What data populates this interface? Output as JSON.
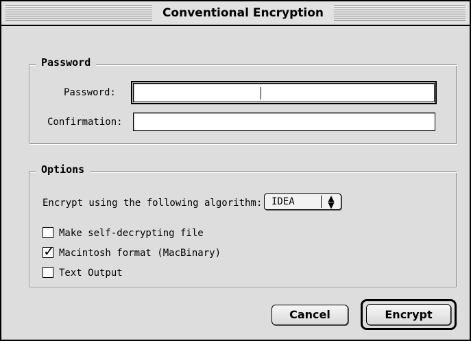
{
  "window": {
    "title": "Conventional Encryption"
  },
  "password_group": {
    "label": "Password",
    "password_label": "Password:",
    "password_value": "",
    "confirmation_label": "Confirmation:",
    "confirmation_value": ""
  },
  "options_group": {
    "label": "Options",
    "algorithm_label": "Encrypt using the following algorithm:",
    "algorithm_selected": "IDEA",
    "checkboxes": [
      {
        "label": "Make self-decrypting file",
        "checked": false
      },
      {
        "label": "Macintosh format (MacBinary)",
        "checked": true
      },
      {
        "label": "Text Output",
        "checked": false
      }
    ]
  },
  "buttons": {
    "cancel_label": "Cancel",
    "encrypt_label": "Encrypt"
  },
  "icons": {
    "popup_arrows": "up-down-arrows-icon",
    "checkmark": "checkmark-icon"
  }
}
